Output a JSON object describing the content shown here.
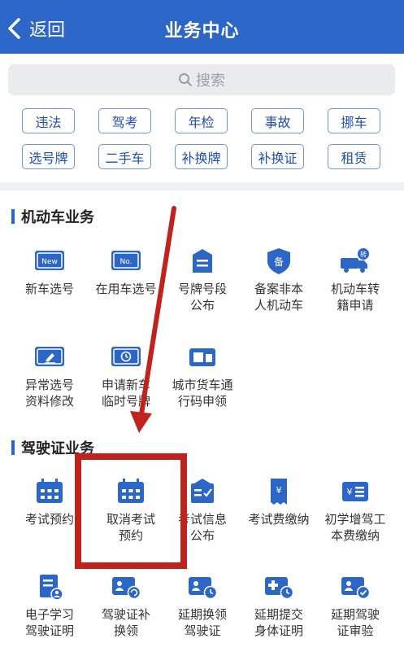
{
  "header": {
    "back_label": "返回",
    "title": "业务中心"
  },
  "search": {
    "placeholder": "搜索"
  },
  "chips": [
    "违法",
    "驾考",
    "年检",
    "事故",
    "挪车",
    "选号牌",
    "二手车",
    "补换牌",
    "补换证",
    "租赁"
  ],
  "sections": [
    {
      "title": "机动车业务",
      "items": [
        {
          "icon": "new-plate-icon",
          "label": "新车选号"
        },
        {
          "icon": "used-plate-icon",
          "label": "在用车选号"
        },
        {
          "icon": "plate-segment-icon",
          "label": "号牌号段\n公布"
        },
        {
          "icon": "register-shield-icon",
          "label": "备案非本\n人机动车"
        },
        {
          "icon": "transfer-truck-icon",
          "label": "机动车转\n籍申请"
        },
        {
          "icon": "edit-card-icon",
          "label": "异常选号\n资料修改"
        },
        {
          "icon": "temp-plate-icon",
          "label": "申请新车\n临时号牌"
        },
        {
          "icon": "truck-pass-icon",
          "label": "城市货车通\n行码申领"
        }
      ]
    },
    {
      "title": "驾驶证业务",
      "items": [
        {
          "icon": "calendar-icon",
          "label": "考试预约"
        },
        {
          "icon": "calendar-cancel-icon",
          "label": "取消考试\n预约"
        },
        {
          "icon": "exam-info-icon",
          "label": "考试信息\n公布"
        },
        {
          "icon": "fee-receipt-icon",
          "label": "考试费缴纳"
        },
        {
          "icon": "fee-list-icon",
          "label": "初学增驾工\n本费缴纳"
        },
        {
          "icon": "study-cert-icon",
          "label": "电子学习\n驾驶证明"
        },
        {
          "icon": "license-renew-icon",
          "label": "驾驶证补\n换领"
        },
        {
          "icon": "license-extend-icon",
          "label": "延期换领\n驾驶证"
        },
        {
          "icon": "health-cert-icon",
          "label": "延期提交\n身体证明"
        },
        {
          "icon": "license-check-icon",
          "label": "延期驾驶\n证审验"
        }
      ]
    }
  ],
  "colors": {
    "header": "#2c66c6",
    "accent": "#2c66c6",
    "annotation": "#c0221e"
  }
}
